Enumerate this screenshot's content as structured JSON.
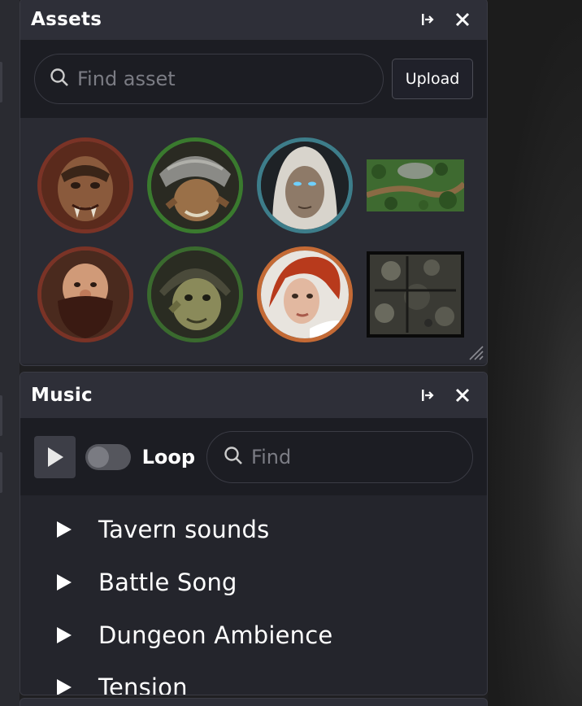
{
  "assets": {
    "title": "Assets",
    "pin_icon": "dock-icon",
    "close_icon": "close-icon",
    "search_placeholder": "Find asset",
    "upload_label": "Upload",
    "items": [
      {
        "name": "orc-warrior-token",
        "ring": "#7a3326"
      },
      {
        "name": "goblin-helmet-token",
        "ring": "#3a7a2e"
      },
      {
        "name": "hooded-figure-token",
        "ring": "#3d7d8a"
      },
      {
        "name": "forest-map",
        "ring": ""
      },
      {
        "name": "dwarf-token",
        "ring": "#7a3326"
      },
      {
        "name": "goblin-hood-token",
        "ring": "#3a6a2e"
      },
      {
        "name": "red-haired-woman-token",
        "ring": "#c46a35"
      },
      {
        "name": "dungeon-map",
        "ring": ""
      }
    ]
  },
  "music": {
    "title": "Music",
    "loop_label": "Loop",
    "loop_enabled": false,
    "search_placeholder": "Find",
    "tracks": [
      {
        "name": "Tavern sounds"
      },
      {
        "name": "Battle Song"
      },
      {
        "name": "Dungeon Ambience"
      },
      {
        "name": "Tension"
      }
    ]
  },
  "colors": {
    "panel_bg": "#24252c",
    "header_bg": "#2e2f38",
    "toolbar_bg": "#1c1d23"
  }
}
